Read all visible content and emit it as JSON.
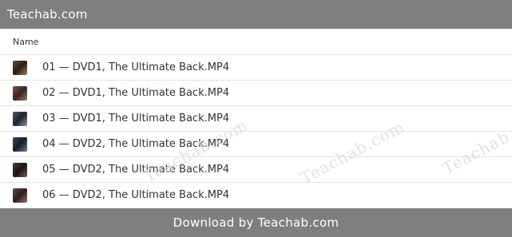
{
  "header": {
    "title": "Teachab.com"
  },
  "table": {
    "column_name": "Name",
    "files": [
      {
        "name": "01 — DVD1, The Ultimate Back.MP4",
        "thumb_icon": "video-thumbnail-icon"
      },
      {
        "name": "02 — DVD1, The Ultimate Back.MP4",
        "thumb_icon": "video-thumbnail-icon"
      },
      {
        "name": "03 — DVD1, The Ultimate Back.MP4",
        "thumb_icon": "video-thumbnail-icon"
      },
      {
        "name": "04 — DVD2, The Ultimate Back.MP4",
        "thumb_icon": "video-thumbnail-icon"
      },
      {
        "name": "05 — DVD2, The Ultimate Back.MP4",
        "thumb_icon": "video-thumbnail-icon"
      },
      {
        "name": "06 — DVD2, The Ultimate Back.MP4",
        "thumb_icon": "video-thumbnail-icon"
      }
    ]
  },
  "watermark": "Teachab.com",
  "footer": {
    "label": "Download by Teachab.com"
  },
  "colors": {
    "bar": "#7f7f7f",
    "text": "#333333",
    "divider": "#e3e3e3"
  }
}
